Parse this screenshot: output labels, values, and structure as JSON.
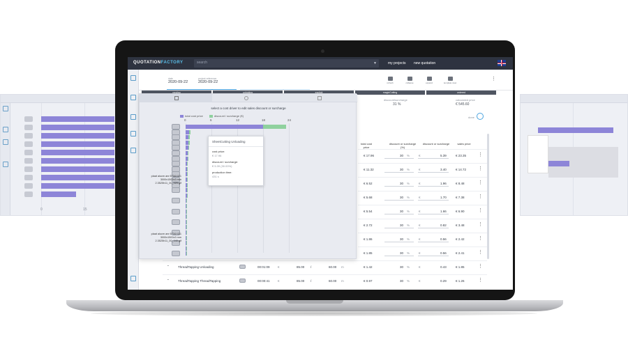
{
  "app": {
    "logo_a": "QUOTATION",
    "logo_b": "FACTORY",
    "search_placeholder": "search",
    "nav": {
      "projects": "my projects",
      "new_quotation": "new quotation"
    }
  },
  "header": {
    "date_label": "date",
    "date_value": "2020-09-22",
    "ref_label": "project reference",
    "ref_value": "2020-09-22",
    "tools": [
      "refresh",
      "collapse",
      "expand",
      "template view"
    ]
  },
  "steps": [
    "nesting",
    "unfolding",
    "explicit",
    "magicCutting",
    "ordered"
  ],
  "summary": {
    "surcharge_label": "discount/surcharge",
    "surcharge_value": "31 %",
    "total_label": "calculated price",
    "total_value": "€ 545.60",
    "done_label": "done"
  },
  "overlay": {
    "title": "select a cost driver to edit sales discount or surcharge",
    "legend_cost": "total cost price",
    "legend_discount": "discount / surcharge (€)",
    "ticks": [
      "0",
      "6",
      "12",
      "18",
      "24"
    ],
    "part_a": [
      "plaat alucm anr:5734 t111",
      "3000x1500x3 mm",
      "2.3525h11_00_020.gif"
    ],
    "part_b": [
      "plaat alucm anr:5734 t111",
      "3000x1500x3 mm",
      "2.3525h11_00_040.gif"
    ]
  },
  "tooltip": {
    "title": "SheetCutting Unloading",
    "cost_label": "cost price:",
    "cost_value": "€ 17.96",
    "disc_label": "discount / surcharge:",
    "disc_value": "€ 5.39 (30.00%)",
    "time_label": "production time:",
    "time_value": "431 s"
  },
  "table": {
    "headers": {
      "total_cost": "total cost price",
      "disc_pct": "discount or surcharge (%)",
      "disc_eur": "discount or surcharge",
      "sales": "sales price"
    },
    "rows": [
      {
        "cost": "€ 17.96",
        "pct": "30",
        "pct_unit": "%",
        "cur": "€",
        "eur": "5.39",
        "sales": "€ 23.35"
      },
      {
        "cost": "€ 11.32",
        "pct": "30",
        "pct_unit": "%",
        "cur": "€",
        "eur": "3.40",
        "sales": "€ 14.72"
      },
      {
        "cost": "€ 6.52",
        "pct": "30",
        "pct_unit": "%",
        "cur": "€",
        "eur": "1.96",
        "sales": "€ 8.48"
      },
      {
        "cost": "€ 5.68",
        "pct": "30",
        "pct_unit": "%",
        "cur": "€",
        "eur": "1.70",
        "sales": "€ 7.38"
      },
      {
        "cost": "€ 5.54",
        "pct": "30",
        "pct_unit": "%",
        "cur": "€",
        "eur": "1.66",
        "sales": "€ 6.90"
      },
      {
        "cost": "€ 2.72",
        "pct": "30",
        "pct_unit": "%",
        "cur": "€",
        "eur": "0.82",
        "sales": "€ 3.48"
      },
      {
        "cost": "€ 1.86",
        "pct": "30",
        "pct_unit": "%",
        "cur": "€",
        "eur": "0.56",
        "sales": "€ 2.42"
      },
      {
        "cost": "€ 1.85",
        "pct": "30",
        "pct_unit": "%",
        "cur": "€",
        "eur": "0.56",
        "sales": "€ 2.41"
      }
    ],
    "bottom_rows": [
      {
        "name": "ThreadTapping Unloading",
        "time": "00:01:09",
        "cur": "€",
        "rate": "85.00",
        "slash": "/",
        "qty": "60.00",
        "unit": "m",
        "cost": "€ 1.42",
        "pct": "30",
        "pct_unit": "%",
        "cur2": "€",
        "eur": "0.43",
        "sales": "€ 1.85"
      },
      {
        "name": "ThreadTapping ThreadTapping",
        "time": "00:00:41",
        "cur": "€",
        "rate": "85.00",
        "slash": "/",
        "qty": "60.00",
        "unit": "m",
        "cost": "€ 0.97",
        "pct": "30",
        "pct_unit": "%",
        "cur2": "€",
        "eur": "0.29",
        "sales": "€ 1.26"
      }
    ]
  },
  "ghost_left": {
    "ticks": [
      "0",
      "15"
    ]
  },
  "chart_data": {
    "type": "bar",
    "orientation": "horizontal",
    "title": "select a cost driver to edit sales discount or surcharge",
    "xlim": [
      0,
      24
    ],
    "series": [
      {
        "name": "total cost price",
        "values": [
          18,
          0.8,
          0.7,
          0.7,
          0.6,
          0.5,
          0.5,
          0.4,
          0.4,
          0.4,
          0.3,
          0.3,
          0.3,
          0.3,
          0.2,
          0.2,
          0.2,
          0.2,
          0.2,
          0.1,
          0.1,
          0.1,
          0.1,
          0.1,
          0.1
        ]
      },
      {
        "name": "discount / surcharge (€)",
        "values": [
          5.39,
          0.3,
          0.3,
          0.2,
          0.2,
          0.2,
          0.1,
          0.1,
          0.1,
          0.1,
          0.1,
          0.1,
          0.1,
          0.1,
          0.1,
          0.1,
          0.1,
          0.1,
          0.1,
          0.05,
          0.05,
          0.05,
          0.05,
          0.05,
          0.05
        ]
      }
    ]
  }
}
